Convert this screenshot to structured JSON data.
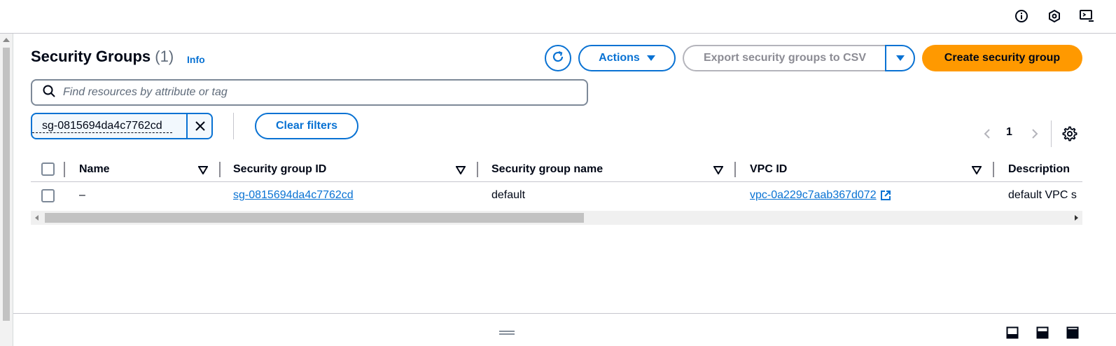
{
  "header": {
    "title": "Security Groups",
    "count": "(1)",
    "info_label": "Info"
  },
  "toolbar": {
    "actions_label": "Actions",
    "export_label": "Export security groups to CSV",
    "create_label": "Create security group",
    "clear_filters_label": "Clear filters"
  },
  "search": {
    "placeholder": "Find resources by attribute or tag",
    "value": ""
  },
  "filter_token": {
    "label": "sg-0815694da4c7762cd"
  },
  "pagination": {
    "current_page": "1"
  },
  "table": {
    "columns": [
      {
        "label": "Name"
      },
      {
        "label": "Security group ID"
      },
      {
        "label": "Security group name"
      },
      {
        "label": "VPC ID"
      },
      {
        "label": "Description"
      }
    ],
    "rows": [
      {
        "name": "–",
        "security_group_id": "sg-0815694da4c7762cd",
        "security_group_name": "default",
        "vpc_id": "vpc-0a229c7aab367d072",
        "description": "default VPC s"
      }
    ]
  },
  "icons": {
    "top_bar": [
      "info-circle-icon",
      "settings-hex-icon",
      "cloudshell-icon"
    ],
    "split_panel": [
      "split-bottom-icon",
      "split-middle-icon",
      "split-full-icon"
    ]
  },
  "colors": {
    "accent": "#0972d3",
    "primary_button": "#ff9900",
    "text": "#000716",
    "muted_text": "#5f6b7a",
    "disabled_text": "#8c8c94"
  }
}
